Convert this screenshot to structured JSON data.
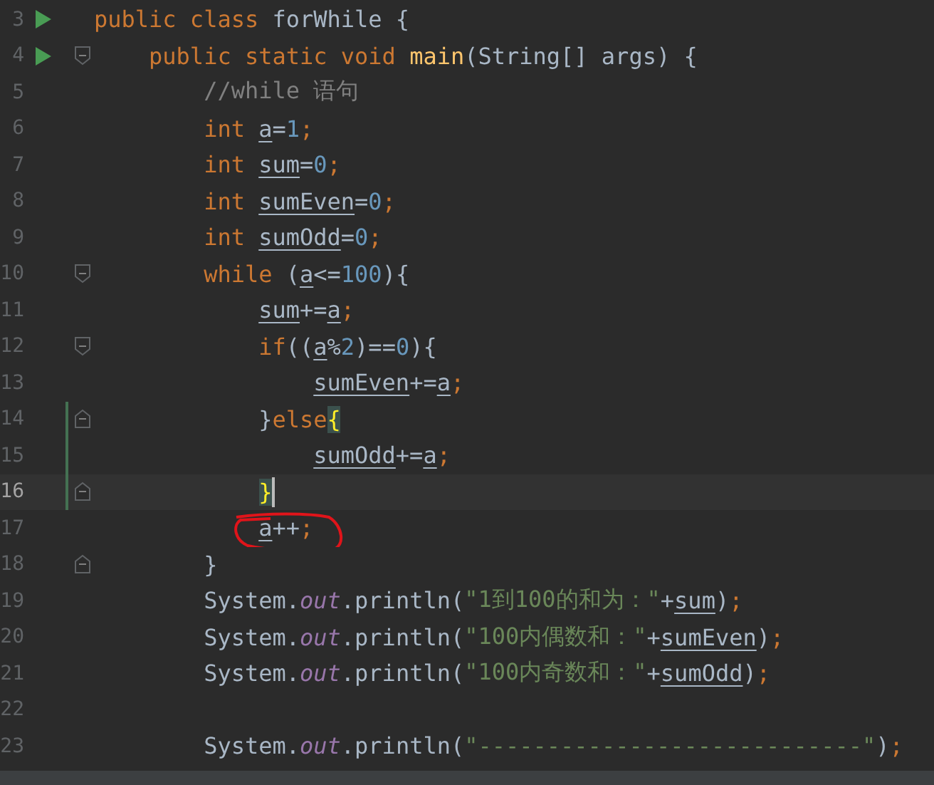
{
  "editor": {
    "lines": [
      {
        "number": "3",
        "run": true,
        "fold_start": false,
        "fold_end": false,
        "changed": false,
        "current": false,
        "circled": false,
        "tokens": [
          {
            "kind": "kw",
            "t": "public class "
          },
          {
            "kind": "plain",
            "t": "forWhile {"
          }
        ]
      },
      {
        "number": "4",
        "run": true,
        "fold_start": true,
        "fold_end": false,
        "changed": false,
        "current": false,
        "circled": false,
        "tokens": [
          {
            "kind": "kw",
            "t": "    public static void "
          },
          {
            "kind": "method",
            "t": "main"
          },
          {
            "kind": "plain",
            "t": "(String[] args) {"
          }
        ]
      },
      {
        "number": "5",
        "run": false,
        "fold_start": false,
        "fold_end": false,
        "changed": false,
        "current": false,
        "circled": false,
        "tokens": [
          {
            "kind": "comment",
            "t": "        //while 语句"
          }
        ]
      },
      {
        "number": "6",
        "run": false,
        "fold_start": false,
        "fold_end": false,
        "changed": false,
        "current": false,
        "circled": false,
        "tokens": [
          {
            "kind": "kw",
            "t": "        int "
          },
          {
            "kind": "var",
            "t": "a"
          },
          {
            "kind": "plain",
            "t": "="
          },
          {
            "kind": "num",
            "t": "1"
          },
          {
            "kind": "kw",
            "t": ";"
          }
        ]
      },
      {
        "number": "7",
        "run": false,
        "fold_start": false,
        "fold_end": false,
        "changed": false,
        "current": false,
        "circled": false,
        "tokens": [
          {
            "kind": "kw",
            "t": "        int "
          },
          {
            "kind": "var",
            "t": "sum"
          },
          {
            "kind": "plain",
            "t": "="
          },
          {
            "kind": "num",
            "t": "0"
          },
          {
            "kind": "kw",
            "t": ";"
          }
        ]
      },
      {
        "number": "8",
        "run": false,
        "fold_start": false,
        "fold_end": false,
        "changed": false,
        "current": false,
        "circled": false,
        "tokens": [
          {
            "kind": "kw",
            "t": "        int "
          },
          {
            "kind": "var",
            "t": "sumEven"
          },
          {
            "kind": "plain",
            "t": "="
          },
          {
            "kind": "num",
            "t": "0"
          },
          {
            "kind": "kw",
            "t": ";"
          }
        ]
      },
      {
        "number": "9",
        "run": false,
        "fold_start": false,
        "fold_end": false,
        "changed": false,
        "current": false,
        "circled": false,
        "tokens": [
          {
            "kind": "kw",
            "t": "        int "
          },
          {
            "kind": "var",
            "t": "sumOdd"
          },
          {
            "kind": "plain",
            "t": "="
          },
          {
            "kind": "num",
            "t": "0"
          },
          {
            "kind": "kw",
            "t": ";"
          }
        ]
      },
      {
        "number": "10",
        "run": false,
        "fold_start": true,
        "fold_end": false,
        "changed": false,
        "current": false,
        "circled": false,
        "tokens": [
          {
            "kind": "kw",
            "t": "        while "
          },
          {
            "kind": "plain",
            "t": "("
          },
          {
            "kind": "var",
            "t": "a"
          },
          {
            "kind": "plain",
            "t": "<="
          },
          {
            "kind": "num",
            "t": "100"
          },
          {
            "kind": "plain",
            "t": "){"
          }
        ]
      },
      {
        "number": "11",
        "run": false,
        "fold_start": false,
        "fold_end": false,
        "changed": false,
        "current": false,
        "circled": false,
        "tokens": [
          {
            "kind": "var",
            "t": "            sum"
          },
          {
            "kind": "plain",
            "t": "+="
          },
          {
            "kind": "var",
            "t": "a"
          },
          {
            "kind": "kw",
            "t": ";"
          }
        ]
      },
      {
        "number": "12",
        "run": false,
        "fold_start": true,
        "fold_end": false,
        "changed": false,
        "current": false,
        "circled": false,
        "tokens": [
          {
            "kind": "kw",
            "t": "            if"
          },
          {
            "kind": "plain",
            "t": "(("
          },
          {
            "kind": "var",
            "t": "a"
          },
          {
            "kind": "plain",
            "t": "%"
          },
          {
            "kind": "num",
            "t": "2"
          },
          {
            "kind": "plain",
            "t": ")=="
          },
          {
            "kind": "num",
            "t": "0"
          },
          {
            "kind": "plain",
            "t": "){"
          }
        ]
      },
      {
        "number": "13",
        "run": false,
        "fold_start": false,
        "fold_end": false,
        "changed": false,
        "current": false,
        "circled": false,
        "tokens": [
          {
            "kind": "var",
            "t": "                sumEven"
          },
          {
            "kind": "plain",
            "t": "+="
          },
          {
            "kind": "var",
            "t": "a"
          },
          {
            "kind": "kw",
            "t": ";"
          }
        ]
      },
      {
        "number": "14",
        "run": false,
        "fold_start": false,
        "fold_end": true,
        "changed": true,
        "current": false,
        "circled": false,
        "tokens": [
          {
            "kind": "plain",
            "t": "            }"
          },
          {
            "kind": "kw",
            "t": "else"
          },
          {
            "kind": "match",
            "t": "{"
          }
        ]
      },
      {
        "number": "15",
        "run": false,
        "fold_start": false,
        "fold_end": false,
        "changed": true,
        "current": false,
        "circled": false,
        "tokens": [
          {
            "kind": "var",
            "t": "                sumOdd"
          },
          {
            "kind": "plain",
            "t": "+="
          },
          {
            "kind": "var",
            "t": "a"
          },
          {
            "kind": "kw",
            "t": ";"
          }
        ]
      },
      {
        "number": "16",
        "run": false,
        "fold_start": false,
        "fold_end": true,
        "changed": true,
        "current": true,
        "circled": false,
        "tokens": [
          {
            "kind": "match",
            "t": "            }"
          }
        ]
      },
      {
        "number": "17",
        "run": false,
        "fold_start": false,
        "fold_end": false,
        "changed": false,
        "current": false,
        "circled": true,
        "tokens": [
          {
            "kind": "var",
            "t": "            a"
          },
          {
            "kind": "plain",
            "t": "++"
          },
          {
            "kind": "kw",
            "t": ";"
          }
        ]
      },
      {
        "number": "18",
        "run": false,
        "fold_start": false,
        "fold_end": true,
        "changed": false,
        "current": false,
        "circled": false,
        "tokens": [
          {
            "kind": "plain",
            "t": "        }"
          }
        ]
      },
      {
        "number": "19",
        "run": false,
        "fold_start": false,
        "fold_end": false,
        "changed": false,
        "current": false,
        "circled": false,
        "tokens": [
          {
            "kind": "plain",
            "t": "        System."
          },
          {
            "kind": "field",
            "t": "out"
          },
          {
            "kind": "plain",
            "t": ".println("
          },
          {
            "kind": "str",
            "t": "\"1到100的和为：\""
          },
          {
            "kind": "plain",
            "t": "+"
          },
          {
            "kind": "var",
            "t": "sum"
          },
          {
            "kind": "plain",
            "t": ")"
          },
          {
            "kind": "kw",
            "t": ";"
          }
        ]
      },
      {
        "number": "20",
        "run": false,
        "fold_start": false,
        "fold_end": false,
        "changed": false,
        "current": false,
        "circled": false,
        "tokens": [
          {
            "kind": "plain",
            "t": "        System."
          },
          {
            "kind": "field",
            "t": "out"
          },
          {
            "kind": "plain",
            "t": ".println("
          },
          {
            "kind": "str",
            "t": "\"100内偶数和：\""
          },
          {
            "kind": "plain",
            "t": "+"
          },
          {
            "kind": "var",
            "t": "sumEven"
          },
          {
            "kind": "plain",
            "t": ")"
          },
          {
            "kind": "kw",
            "t": ";"
          }
        ]
      },
      {
        "number": "21",
        "run": false,
        "fold_start": false,
        "fold_end": false,
        "changed": false,
        "current": false,
        "circled": false,
        "tokens": [
          {
            "kind": "plain",
            "t": "        System."
          },
          {
            "kind": "field",
            "t": "out"
          },
          {
            "kind": "plain",
            "t": ".println("
          },
          {
            "kind": "str",
            "t": "\"100内奇数和：\""
          },
          {
            "kind": "plain",
            "t": "+"
          },
          {
            "kind": "var",
            "t": "sumOdd"
          },
          {
            "kind": "plain",
            "t": ")"
          },
          {
            "kind": "kw",
            "t": ";"
          }
        ]
      },
      {
        "number": "22",
        "run": false,
        "fold_start": false,
        "fold_end": false,
        "changed": false,
        "current": false,
        "circled": false
      },
      {
        "number": "23",
        "run": false,
        "fold_start": false,
        "fold_end": false,
        "changed": false,
        "current": false,
        "circled": false,
        "tokens": [
          {
            "kind": "plain",
            "t": "        System."
          },
          {
            "kind": "field",
            "t": "out"
          },
          {
            "kind": "plain",
            "t": ".println("
          },
          {
            "kind": "str",
            "t": "\"----------------------------\""
          },
          {
            "kind": "plain",
            "t": ")"
          },
          {
            "kind": "kw",
            "t": ";"
          }
        ]
      }
    ]
  }
}
